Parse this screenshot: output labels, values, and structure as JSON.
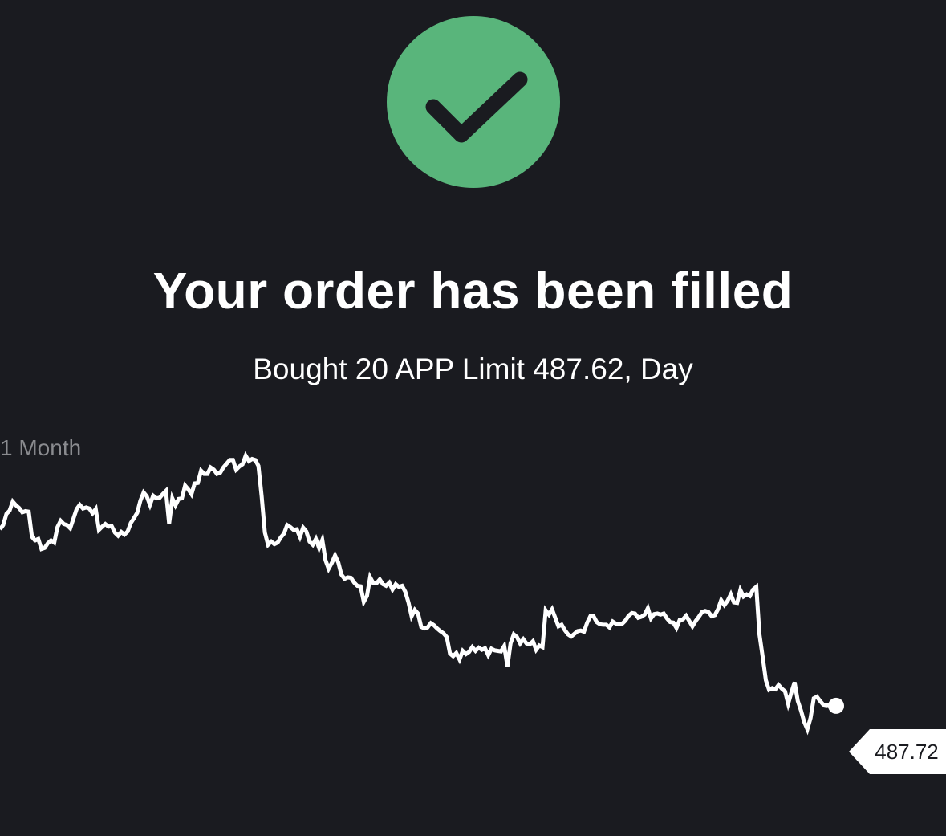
{
  "status": {
    "icon": "check-icon",
    "color": "#59b57b"
  },
  "title": "Your order has been filled",
  "order_summary": "Bought 20 APP Limit 487.62, Day",
  "chart_range_label": "1 Month",
  "current_price_label": "487.72",
  "colors": {
    "background": "#1a1b20",
    "line": "#ffffff",
    "muted_text": "#8a8b8f"
  },
  "chart_data": {
    "type": "line",
    "title": "",
    "xlabel": "",
    "ylabel": "",
    "grid": false,
    "legend": "none",
    "ylim": [
      478,
      550
    ],
    "series": [
      {
        "values": [
          529.8,
          530.6,
          532.7,
          533.3,
          535.0,
          534.3,
          533.8,
          533.0,
          533.2,
          533.1,
          528.4,
          527.7,
          528.0,
          526.1,
          526.3,
          527.2,
          527.7,
          527.3,
          530.2,
          531.4,
          530.8,
          530.6,
          530.0,
          531.8,
          533.6,
          534.4,
          533.7,
          533.9,
          533.7,
          532.8,
          533.6,
          529.7,
          530.3,
          530.8,
          530.3,
          530.4,
          529.2,
          528.6,
          529.3,
          528.8,
          529.4,
          531.0,
          531.9,
          532.9,
          535.2,
          536.7,
          536.0,
          534.4,
          536.1,
          535.6,
          535.7,
          536.4,
          537.0,
          530.9,
          535.6,
          534.3,
          535.5,
          535.6,
          538.0,
          537.3,
          536.4,
          538.4,
          538.5,
          540.8,
          540.2,
          540.2,
          541.4,
          541.0,
          540.2,
          540.4,
          541.4,
          542.1,
          542.8,
          542.8,
          541.0,
          541.6,
          542.0,
          543.6,
          542.6,
          543.0,
          542.8,
          541.7,
          536.0,
          529.2,
          526.9,
          527.5,
          527.0,
          527.3,
          528.3,
          529.0,
          530.6,
          530.2,
          529.7,
          529.8,
          528.4,
          530.1,
          529.4,
          527.5,
          526.9,
          528.0,
          526.3,
          527.8,
          524.0,
          522.4,
          523.5,
          524.9,
          523.6,
          521.3,
          520.5,
          520.8,
          520.7,
          519.8,
          519.2,
          519.1,
          516.2,
          517.3,
          520.8,
          519.7,
          519.7,
          520.4,
          519.5,
          519.2,
          519.8,
          518.5,
          519.5,
          519.0,
          519.2,
          518.1,
          516.1,
          513.5,
          514.7,
          514.0,
          511.5,
          511.2,
          511.4,
          512.2,
          511.8,
          511.2,
          510.7,
          510.3,
          509.6,
          506.5,
          506.0,
          506.6,
          505.4,
          507.0,
          506.4,
          506.8,
          507.7,
          507.0,
          507.6,
          507.2,
          507.5,
          506.2,
          507.4,
          507.1,
          507.0,
          506.9,
          507.9,
          504.1,
          508.4,
          510.1,
          509.6,
          508.4,
          509.2,
          508.4,
          508.2,
          508.8,
          507.2,
          508.0,
          507.7,
          514.6,
          513.8,
          514.8,
          513.2,
          511.6,
          511.9,
          510.9,
          510.1,
          509.7,
          510.2,
          510.7,
          510.8,
          510.6,
          512.3,
          513.5,
          513.5,
          512.4,
          512.0,
          511.9,
          511.9,
          511.4,
          512.5,
          512.1,
          512.1,
          512.1,
          512.7,
          513.6,
          514.1,
          514.0,
          513.2,
          513.4,
          513.8,
          515.0,
          513.1,
          513.9,
          514.0,
          513.8,
          514.0,
          513.1,
          512.4,
          512.3,
          511.3,
          512.8,
          512.9,
          513.6,
          512.6,
          511.6,
          512.6,
          513.4,
          514.3,
          514.5,
          514.3,
          513.5,
          513.7,
          514.8,
          516.5,
          515.6,
          516.4,
          517.6,
          516.1,
          516.0,
          518.4,
          517.2,
          517.6,
          517.3,
          518.5,
          519.0,
          510.1,
          505.9,
          501.5,
          499.7,
          500.0,
          499.8,
          500.6,
          499.9,
          499.4,
          497.1,
          499.2,
          501.1,
          497.6,
          495.8,
          493.7,
          492.3,
          494.4,
          498.1,
          498.4,
          497.6,
          496.9,
          496.8,
          496.9,
          496.8,
          496.7
        ]
      }
    ],
    "end_label": "487.72"
  }
}
